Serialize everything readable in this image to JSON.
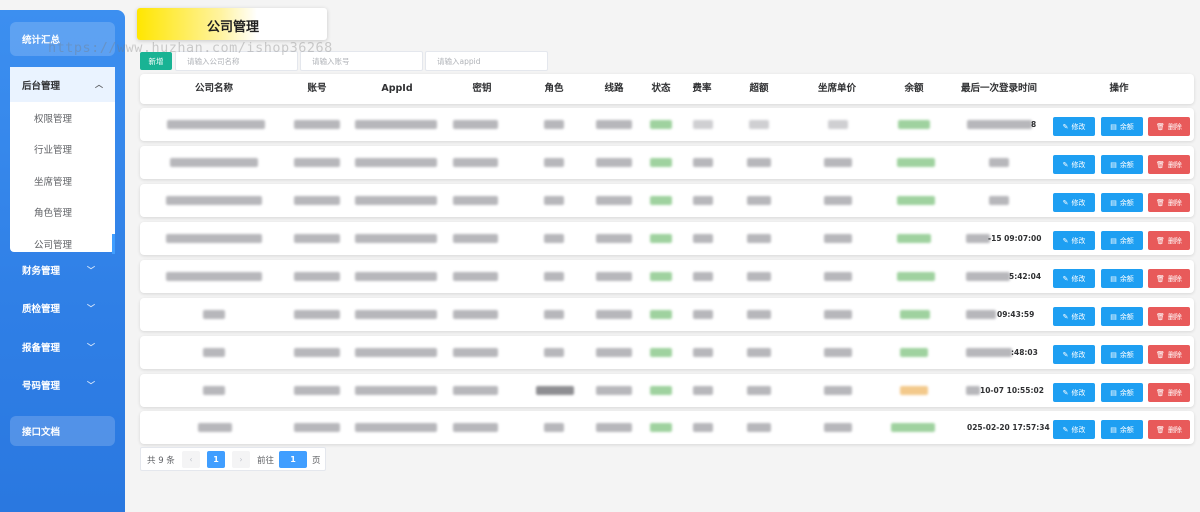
{
  "watermark": "https://www.huzhan.com/ishop36268",
  "sidebar": {
    "top_item": "统计汇总",
    "group": {
      "label": "后台管理",
      "items": [
        "权限管理",
        "行业管理",
        "坐席管理",
        "角色管理",
        "公司管理"
      ],
      "active": "公司管理"
    },
    "items": [
      "财务管理",
      "质检管理",
      "报备管理",
      "号码管理"
    ],
    "doc_item": "接口文档"
  },
  "page": {
    "title": "公司管理"
  },
  "toolbar": {
    "new_label": "新增",
    "search_company_placeholder": "请输入公司名称",
    "search_account_placeholder": "请输入账号",
    "search_appid_placeholder": "请输入appid"
  },
  "table": {
    "columns": [
      "公司名称",
      "账号",
      "AppId",
      "密钥",
      "角色",
      "线路",
      "状态",
      "费率",
      "超额",
      "坐席单价",
      "余额",
      "最后一次登录时间",
      "操作"
    ],
    "rows": [
      {
        "last_login": "8"
      },
      {
        "last_login": ""
      },
      {
        "last_login": ""
      },
      {
        "last_login": "-15 09:07:00"
      },
      {
        "last_login": "5:42:04"
      },
      {
        "last_login": "09:43:59"
      },
      {
        "last_login": ":48:03"
      },
      {
        "last_login": "10-07 10:55:02"
      },
      {
        "last_login": "025-02-20 17:57:34"
      }
    ],
    "actions": {
      "edit": "修改",
      "balance": "余额",
      "delete": "删除"
    }
  },
  "pagination": {
    "total_text": "共 9 条",
    "current_page": "1",
    "goto_label": "前往",
    "goto_value": "1",
    "page_suffix": "页"
  },
  "colors": {
    "sidebar": "#2f7fe6",
    "new_button": "#19b394",
    "edit_button": "#1e9ff2",
    "delete_button": "#e85a5a",
    "pager_active": "#409eff"
  }
}
